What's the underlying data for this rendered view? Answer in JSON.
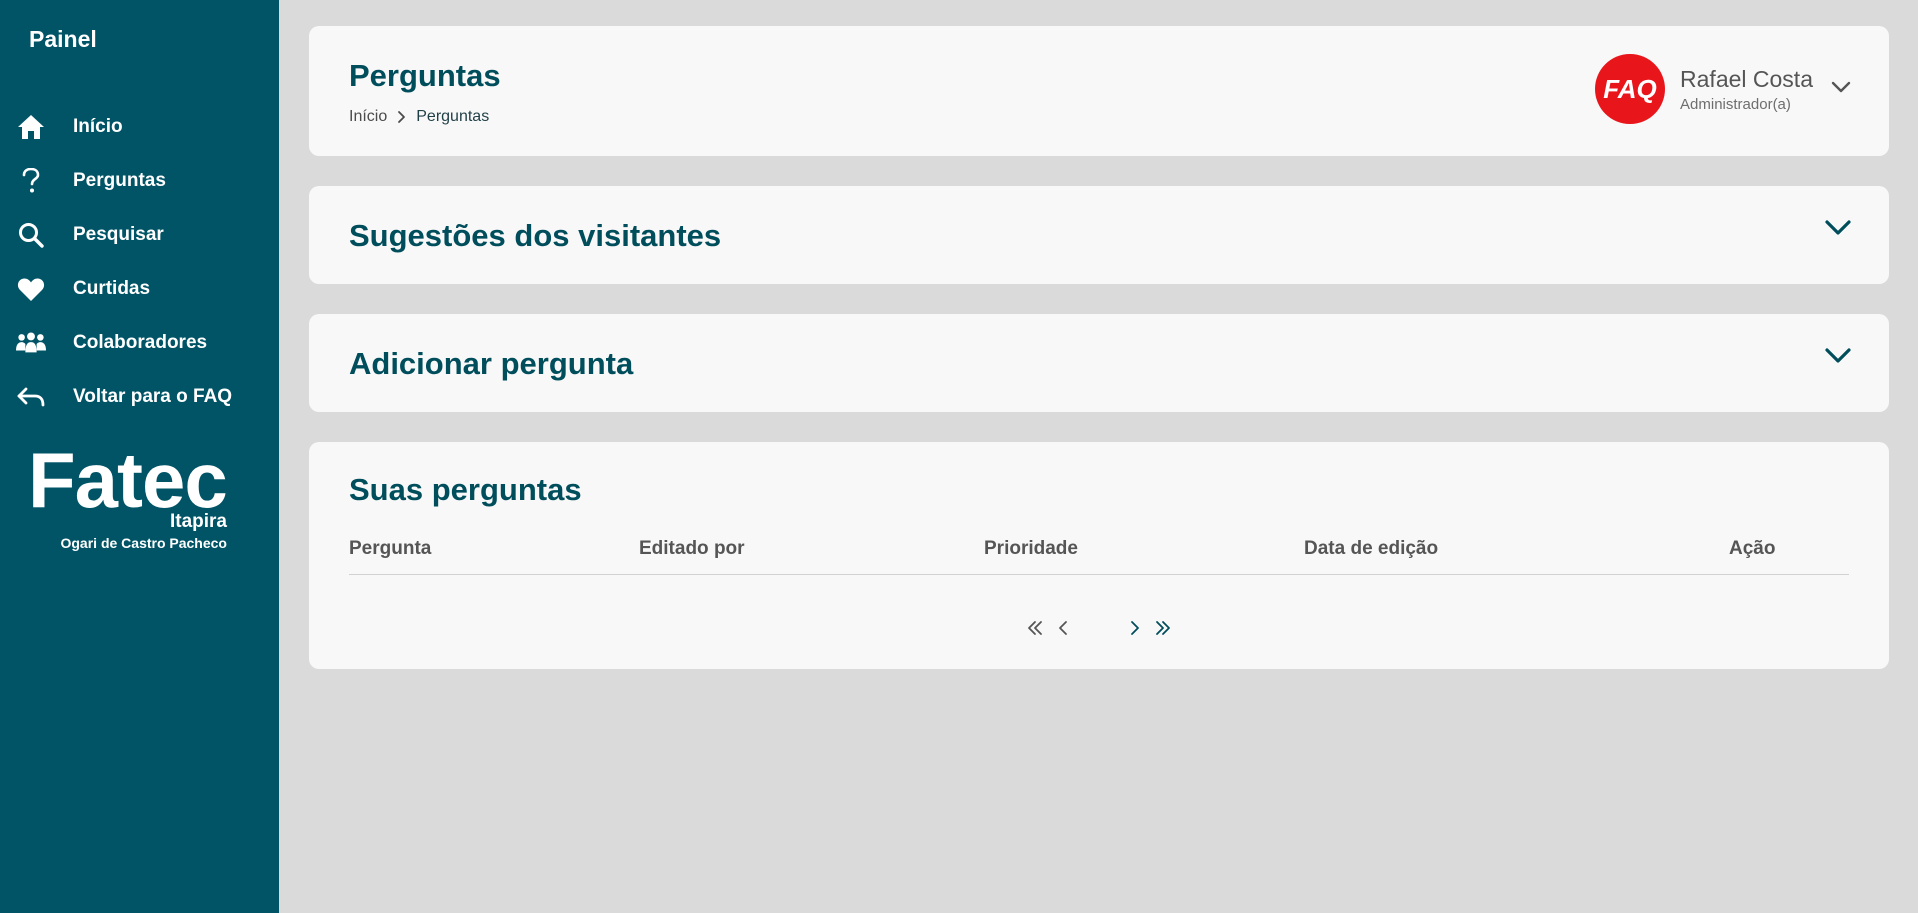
{
  "sidebar": {
    "title": "Painel",
    "items": [
      {
        "label": "Início",
        "icon": "home-icon"
      },
      {
        "label": "Perguntas",
        "icon": "question-icon"
      },
      {
        "label": "Pesquisar",
        "icon": "search-icon"
      },
      {
        "label": "Curtidas",
        "icon": "heart-icon"
      },
      {
        "label": "Colaboradores",
        "icon": "users-icon"
      },
      {
        "label": "Voltar para o FAQ",
        "icon": "back-arrow-icon"
      }
    ],
    "logo": {
      "main": "Fatec",
      "city": "Itapira",
      "subtitle": "Ogari de Castro Pacheco"
    }
  },
  "header": {
    "title": "Perguntas",
    "breadcrumb": [
      "Início",
      "Perguntas"
    ],
    "user": {
      "avatar_text": "FAQ",
      "name": "Rafael Costa",
      "role": "Administrador(a)"
    }
  },
  "sections": {
    "suggestions": {
      "title": "Sugestões dos visitantes"
    },
    "add_question": {
      "title": "Adicionar pergunta"
    }
  },
  "questions_table": {
    "title": "Suas perguntas",
    "columns": [
      "Pergunta",
      "Editado por",
      "Prioridade",
      "Data de edição",
      "Ação"
    ],
    "rows": []
  },
  "colors": {
    "sidebar_bg": "#005466",
    "accent_text": "#004d5c",
    "page_bg": "#dadada",
    "card_bg": "#f8f8f8",
    "avatar_bg": "#e8151b"
  }
}
